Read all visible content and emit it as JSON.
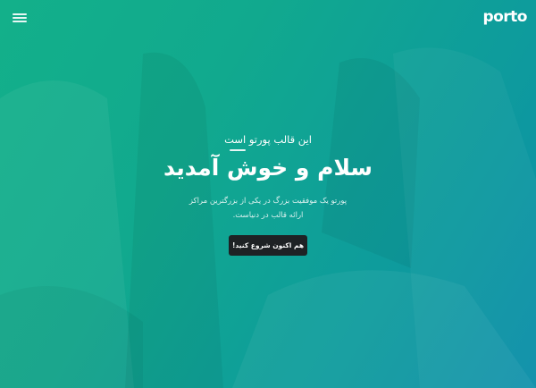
{
  "header": {
    "logo_text": "porto",
    "menu_icon": "hamburger-menu-icon"
  },
  "hero": {
    "subtitle": "این قالب پورتو است",
    "title": "سلام و خوش آمدید",
    "description_line1": "پورتو یک موفقیت بزرگ در یکی از بزرگترین مراکز",
    "description_line2": "ارائه قالب در دنیاست.",
    "cta_label": "هم اکنون شروع کنید!"
  },
  "colors": {
    "gradient_start": "#13b08a",
    "gradient_end": "#0b8ea9",
    "button_bg": "#1e2225",
    "text": "#ffffff"
  }
}
